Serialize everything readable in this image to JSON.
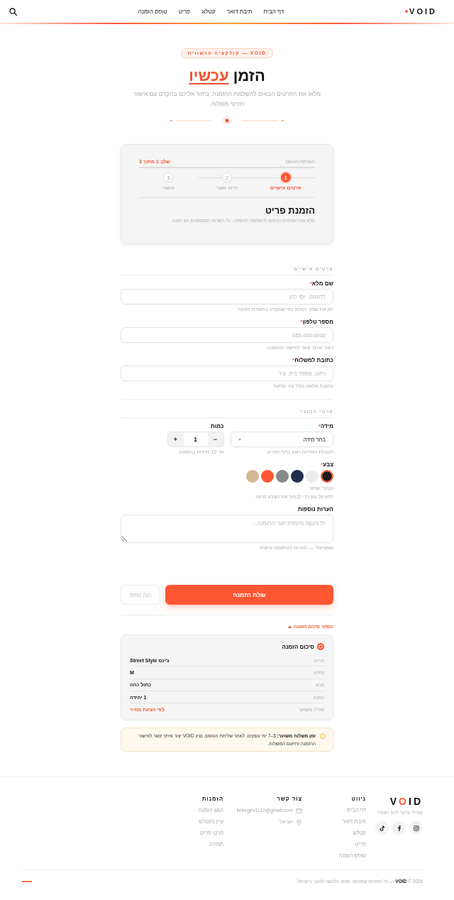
{
  "header": {
    "logo": "VOID",
    "nav": [
      "דף הבית",
      "תיבת דואר",
      "קטלוג",
      "פריט",
      "טופס הזמנה"
    ]
  },
  "hero": {
    "badge": "VOID — קולקציה עכשווית",
    "title": "הזמן",
    "title_accent": "עכשיו",
    "subtitle": "מלאו את הפרטים הבאים להשלמת ההזמנה. נחזור אליכם בהקדם עם אישור ופרטי משלוח."
  },
  "form_card": {
    "progress_label": "השלמת הטופס",
    "step_counter": "שלב 1 מתוך 3",
    "steps": [
      {
        "number": "1",
        "label": "פרטים אישיים",
        "selected": true
      },
      {
        "number": "2",
        "label": "פרטי מוצר",
        "selected": false
      },
      {
        "number": "3",
        "label": "אישור",
        "selected": false
      }
    ],
    "title": "הזמנת פריט",
    "subtitle": "מלא את הפרטים הבאים להשלמת ההזמנה. כל השדות המסומנים הם חובה."
  },
  "personal_details": {
    "title": "פרטים אישיים",
    "fields": [
      {
        "label": "שם מלא",
        "required_mark": "*",
        "placeholder": "לדוגמה: יוסי כהן",
        "hint": "הזן את שמך המלא כפי שמופיע בתעודת הזהות"
      },
      {
        "label": "מספר טלפון",
        "required_mark": "*",
        "placeholder": "050-000-0000",
        "hint": "ניצור איתך קשר לאישור ההזמנה."
      },
      {
        "label": "כתובת למשלוח",
        "required_mark": "*",
        "placeholder": "רחוב, מספר בית, עיר",
        "hint": "כתובת מלאה כולל עיר ומיקוד"
      }
    ]
  },
  "product_details": {
    "title": "פרטי המוצר",
    "size": {
      "label": "מידה",
      "required_mark": "*",
      "value": "בחר מידה",
      "hint": "לטבלת המידות ראה בדף הפריט"
    },
    "quantity": {
      "label": "כמות",
      "decrement": "−",
      "value": "1",
      "increment": "+",
      "hint": "עד 10 יחידות בהזמנה"
    },
    "color": {
      "label": "צבע",
      "required_mark": "*",
      "swatches": [
        {
          "color": "#1a1a1a",
          "selected": true
        },
        {
          "color": "#ececec",
          "selected": false
        },
        {
          "color": "#1f2d4d",
          "selected": false
        },
        {
          "color": "#888888",
          "selected": false
        },
        {
          "color": "#ff5733",
          "selected": false
        },
        {
          "color": "#d4b896",
          "selected": false
        }
      ],
      "selected_text": "נבחר: שחור",
      "hint": "לחץ על גוון כדי לבחור את הצבע הרצוי"
    },
    "notes": {
      "label": "הערות נוספות",
      "placeholder": "כל בקשה מיוחדת לגבי ההזמנה...",
      "hint": "אופציונלי — הערות להתאמה אישית"
    }
  },
  "actions": {
    "submit": "שלח הזמנה",
    "reset": "נקה טופס"
  },
  "summary": {
    "toggle": "הסתר סיכום הזמנה",
    "expanded": true,
    "title": "סיכום הזמנה",
    "rows": [
      {
        "label": "פריט",
        "value": "ג'ינס Street Style",
        "kind": "plain"
      },
      {
        "label": "מידה",
        "value": "M",
        "kind": "plain"
      },
      {
        "label": "צבע",
        "value": "כחול כהה",
        "kind": "plain"
      },
      {
        "label": "כמות",
        "value": "1 יחידה",
        "kind": "plain"
      },
      {
        "label": "סה\"כ משוער",
        "value": "לפי הצעת מחיר",
        "kind": "accent"
      }
    ]
  },
  "notice": {
    "text": "**זמן משלוח משוער:** 5–7 ימי עסקים. לאחר שליחת הטופס, נציג VOID יצור איתך קשר לאישור ההזמנה ותיאום המשלוח."
  },
  "footer": {
    "logo": "VOID",
    "tagline": "סטייל עירוני לדור הצעיר",
    "columns": [
      {
        "title": "ניווט",
        "items": [
          {
            "kind": "link",
            "text": "דף הבית"
          },
          {
            "kind": "link",
            "text": "תיבת דואר"
          },
          {
            "kind": "link",
            "text": "קטלוג"
          },
          {
            "kind": "link",
            "text": "פריט"
          },
          {
            "kind": "link",
            "text": "טופס הזמנה"
          }
        ]
      },
      {
        "title": "צור קשר",
        "items": [
          {
            "kind": "email",
            "text": "lielregev1110@gmail.com"
          },
          {
            "kind": "location",
            "text": "ישראל"
          }
        ]
      },
      {
        "title": "הזמנות",
        "items": [
          {
            "kind": "link",
            "text": "הגש הזמנה"
          },
          {
            "kind": "link",
            "text": "עיין בקטלוג"
          },
          {
            "kind": "link",
            "text": "פרטי פריט"
          },
          {
            "kind": "link",
            "text": "תמיכה"
          }
        ]
      }
    ],
    "copyright": "2026 © **VOID** — כל הזכויות שמורות. מותג הלבשה לנוער בישראל."
  }
}
